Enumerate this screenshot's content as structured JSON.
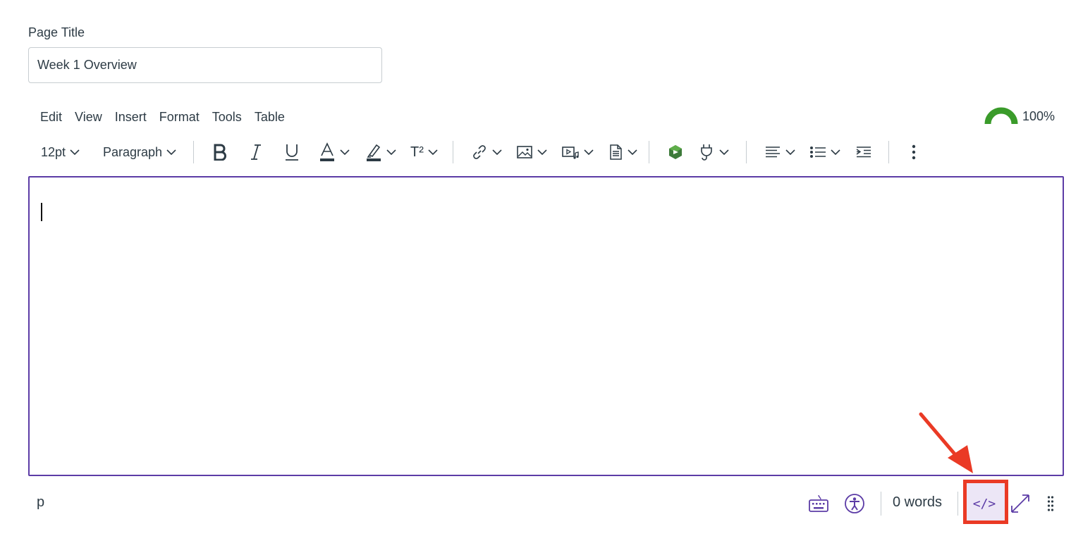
{
  "title_field": {
    "label": "Page Title",
    "value": "Week 1 Overview"
  },
  "menubar": {
    "items": [
      "Edit",
      "View",
      "Insert",
      "Format",
      "Tools",
      "Table"
    ]
  },
  "score": {
    "value": "100%",
    "color": "#3a9b2a"
  },
  "toolbar": {
    "font_size": "12pt",
    "block_format": "Paragraph",
    "superscript_label": "T²"
  },
  "statusbar": {
    "path": "p",
    "word_count": "0 words",
    "html_toggle": "</>"
  },
  "colors": {
    "accent": "#5c3ca6",
    "annotation": "#ea3a25",
    "text": "#2d3b45"
  }
}
